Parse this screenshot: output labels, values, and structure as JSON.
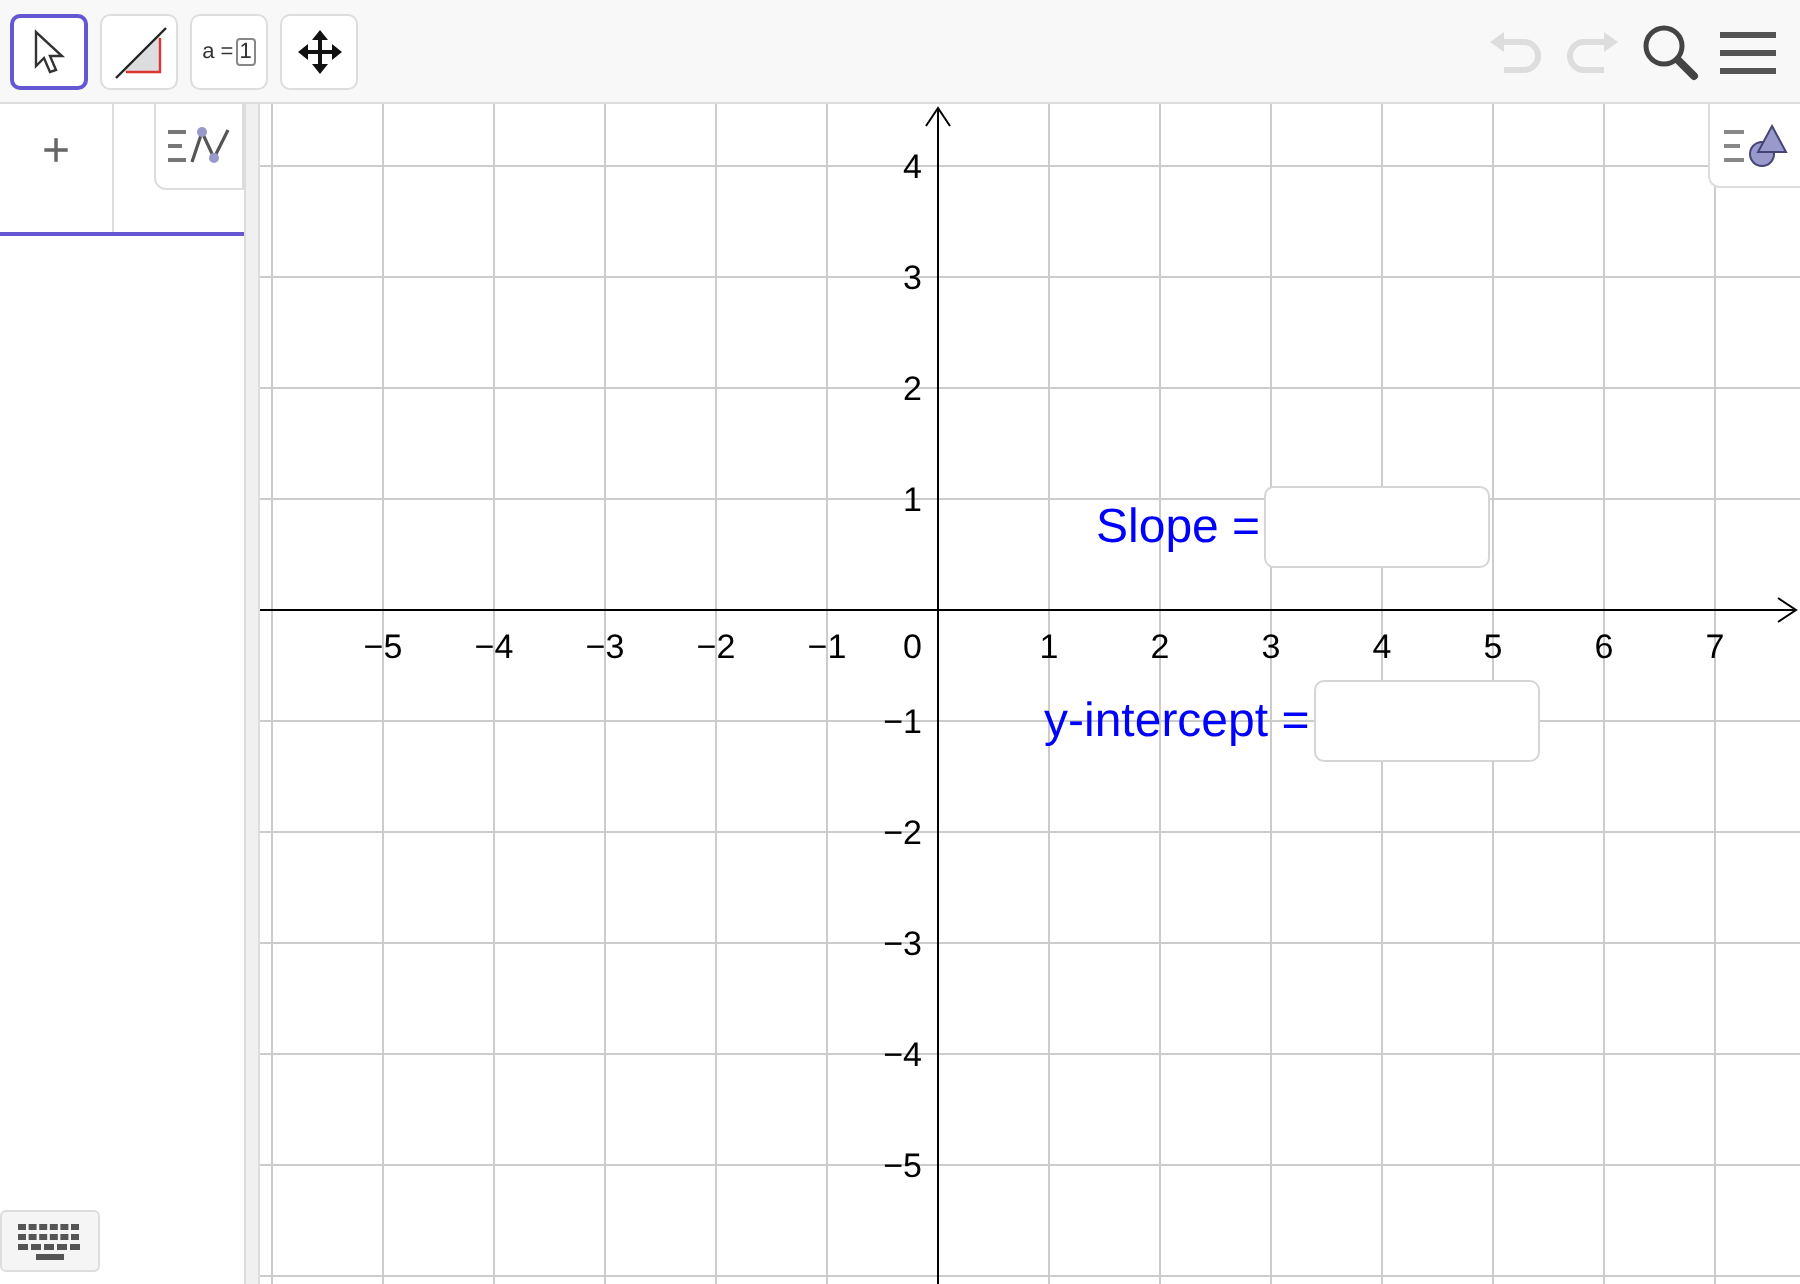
{
  "toolbar": {
    "tools": [
      {
        "kind": "pointer",
        "selected": true
      },
      {
        "kind": "line",
        "selected": false
      },
      {
        "kind": "slider",
        "selected": false,
        "label": "a =",
        "value": "1"
      },
      {
        "kind": "move",
        "selected": false
      }
    ],
    "undo": {
      "disabled": true
    },
    "redo": {
      "disabled": true
    }
  },
  "algebra": {
    "add_symbol": "+"
  },
  "graph": {
    "origin_label": "0",
    "x_labels": [
      "−5",
      "−4",
      "−3",
      "−2",
      "−1",
      "1",
      "2",
      "3",
      "4",
      "5",
      "6",
      "7"
    ],
    "y_labels": [
      "4",
      "3",
      "2",
      "1",
      "−1",
      "−2",
      "−3",
      "−4",
      "−5"
    ],
    "fields": [
      {
        "label": "Slope ="
      },
      {
        "label": "y-intercept ="
      }
    ]
  }
}
